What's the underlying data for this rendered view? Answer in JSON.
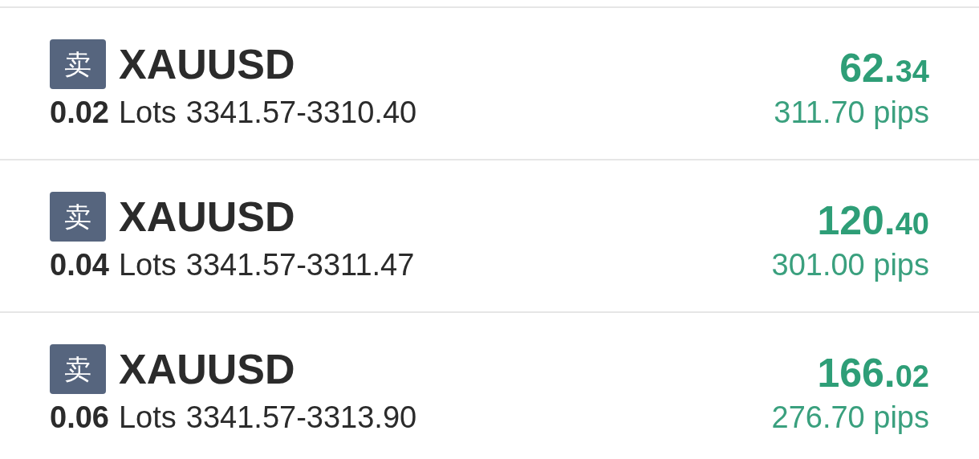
{
  "positions": [
    {
      "side": "卖",
      "symbol": "XAUUSD",
      "lots": "0.02",
      "lots_unit": "Lots",
      "price_range": "3341.57-3310.40",
      "profit_int": "62.",
      "profit_dec": "34",
      "pips": "311.70 pips"
    },
    {
      "side": "卖",
      "symbol": "XAUUSD",
      "lots": "0.04",
      "lots_unit": "Lots",
      "price_range": "3341.57-3311.47",
      "profit_int": "120.",
      "profit_dec": "40",
      "pips": "301.00 pips"
    },
    {
      "side": "卖",
      "symbol": "XAUUSD",
      "lots": "0.06",
      "lots_unit": "Lots",
      "price_range": "3341.57-3313.90",
      "profit_int": "166.",
      "profit_dec": "02",
      "pips": "276.70 pips"
    }
  ]
}
